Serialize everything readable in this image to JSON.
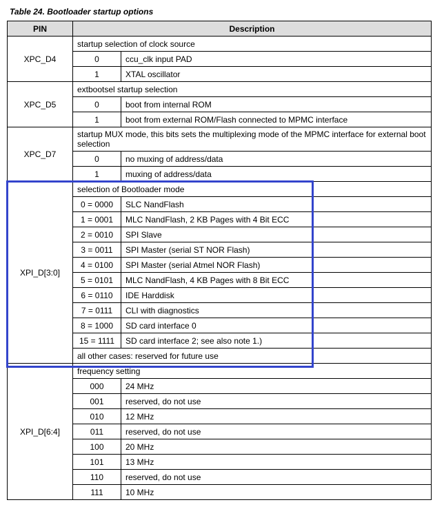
{
  "caption": "Table 24.  Bootloader startup options",
  "headers": {
    "pin": "PIN",
    "desc": "Description"
  },
  "groups": [
    {
      "pin": "XPC_D4",
      "title": "startup selection of clock source",
      "rows": [
        {
          "val": "0",
          "desc": "ccu_clk input PAD"
        },
        {
          "val": "1",
          "desc": "XTAL oscillator"
        }
      ]
    },
    {
      "pin": "XPC_D5",
      "title": "extbootsel startup selection",
      "rows": [
        {
          "val": "0",
          "desc": "boot from internal ROM"
        },
        {
          "val": "1",
          "desc": "boot from external ROM/Flash connected to MPMC interface"
        }
      ]
    },
    {
      "pin": "XPC_D7",
      "title": "startup MUX mode, this bits sets the multiplexing mode of the MPMC interface for external boot selection",
      "rows": [
        {
          "val": "0",
          "desc": "no muxing of address/data"
        },
        {
          "val": "1",
          "desc": "muxing of address/data"
        }
      ]
    },
    {
      "pin": "XPI_D[3:0]",
      "title": "selection of Bootloader mode",
      "rows": [
        {
          "val": "0 = 0000",
          "desc": "SLC NandFlash"
        },
        {
          "val": "1 = 0001",
          "desc": "MLC NandFlash, 2 KB Pages with 4 Bit ECC"
        },
        {
          "val": "2 = 0010",
          "desc": "SPI Slave"
        },
        {
          "val": "3 = 0011",
          "desc": "SPI Master (serial ST NOR Flash)"
        },
        {
          "val": "4 = 0100",
          "desc": "SPI Master (serial Atmel NOR Flash)"
        },
        {
          "val": "5 = 0101",
          "desc": "MLC NandFlash, 4 KB Pages with 8 Bit ECC"
        },
        {
          "val": "6 = 0110",
          "desc": "IDE Harddisk"
        },
        {
          "val": "7 = 0111",
          "desc": "CLI with diagnostics"
        },
        {
          "val": "8 = 1000",
          "desc": "SD card interface 0"
        },
        {
          "val": "15 = 1111",
          "desc": "SD card interface 2; see also note 1.)"
        }
      ],
      "footer": "all other cases: reserved for future use"
    },
    {
      "pin": "XPI_D[6:4]",
      "title": "frequency setting",
      "rows": [
        {
          "val": "000",
          "desc": "24 MHz"
        },
        {
          "val": "001",
          "desc": "reserved, do not use"
        },
        {
          "val": "010",
          "desc": "12 MHz"
        },
        {
          "val": "011",
          "desc": "reserved, do not use"
        },
        {
          "val": "100",
          "desc": "20 MHz"
        },
        {
          "val": "101",
          "desc": "13 MHz"
        },
        {
          "val": "110",
          "desc": "reserved, do not use"
        },
        {
          "val": "111",
          "desc": "10 MHz"
        }
      ]
    }
  ]
}
